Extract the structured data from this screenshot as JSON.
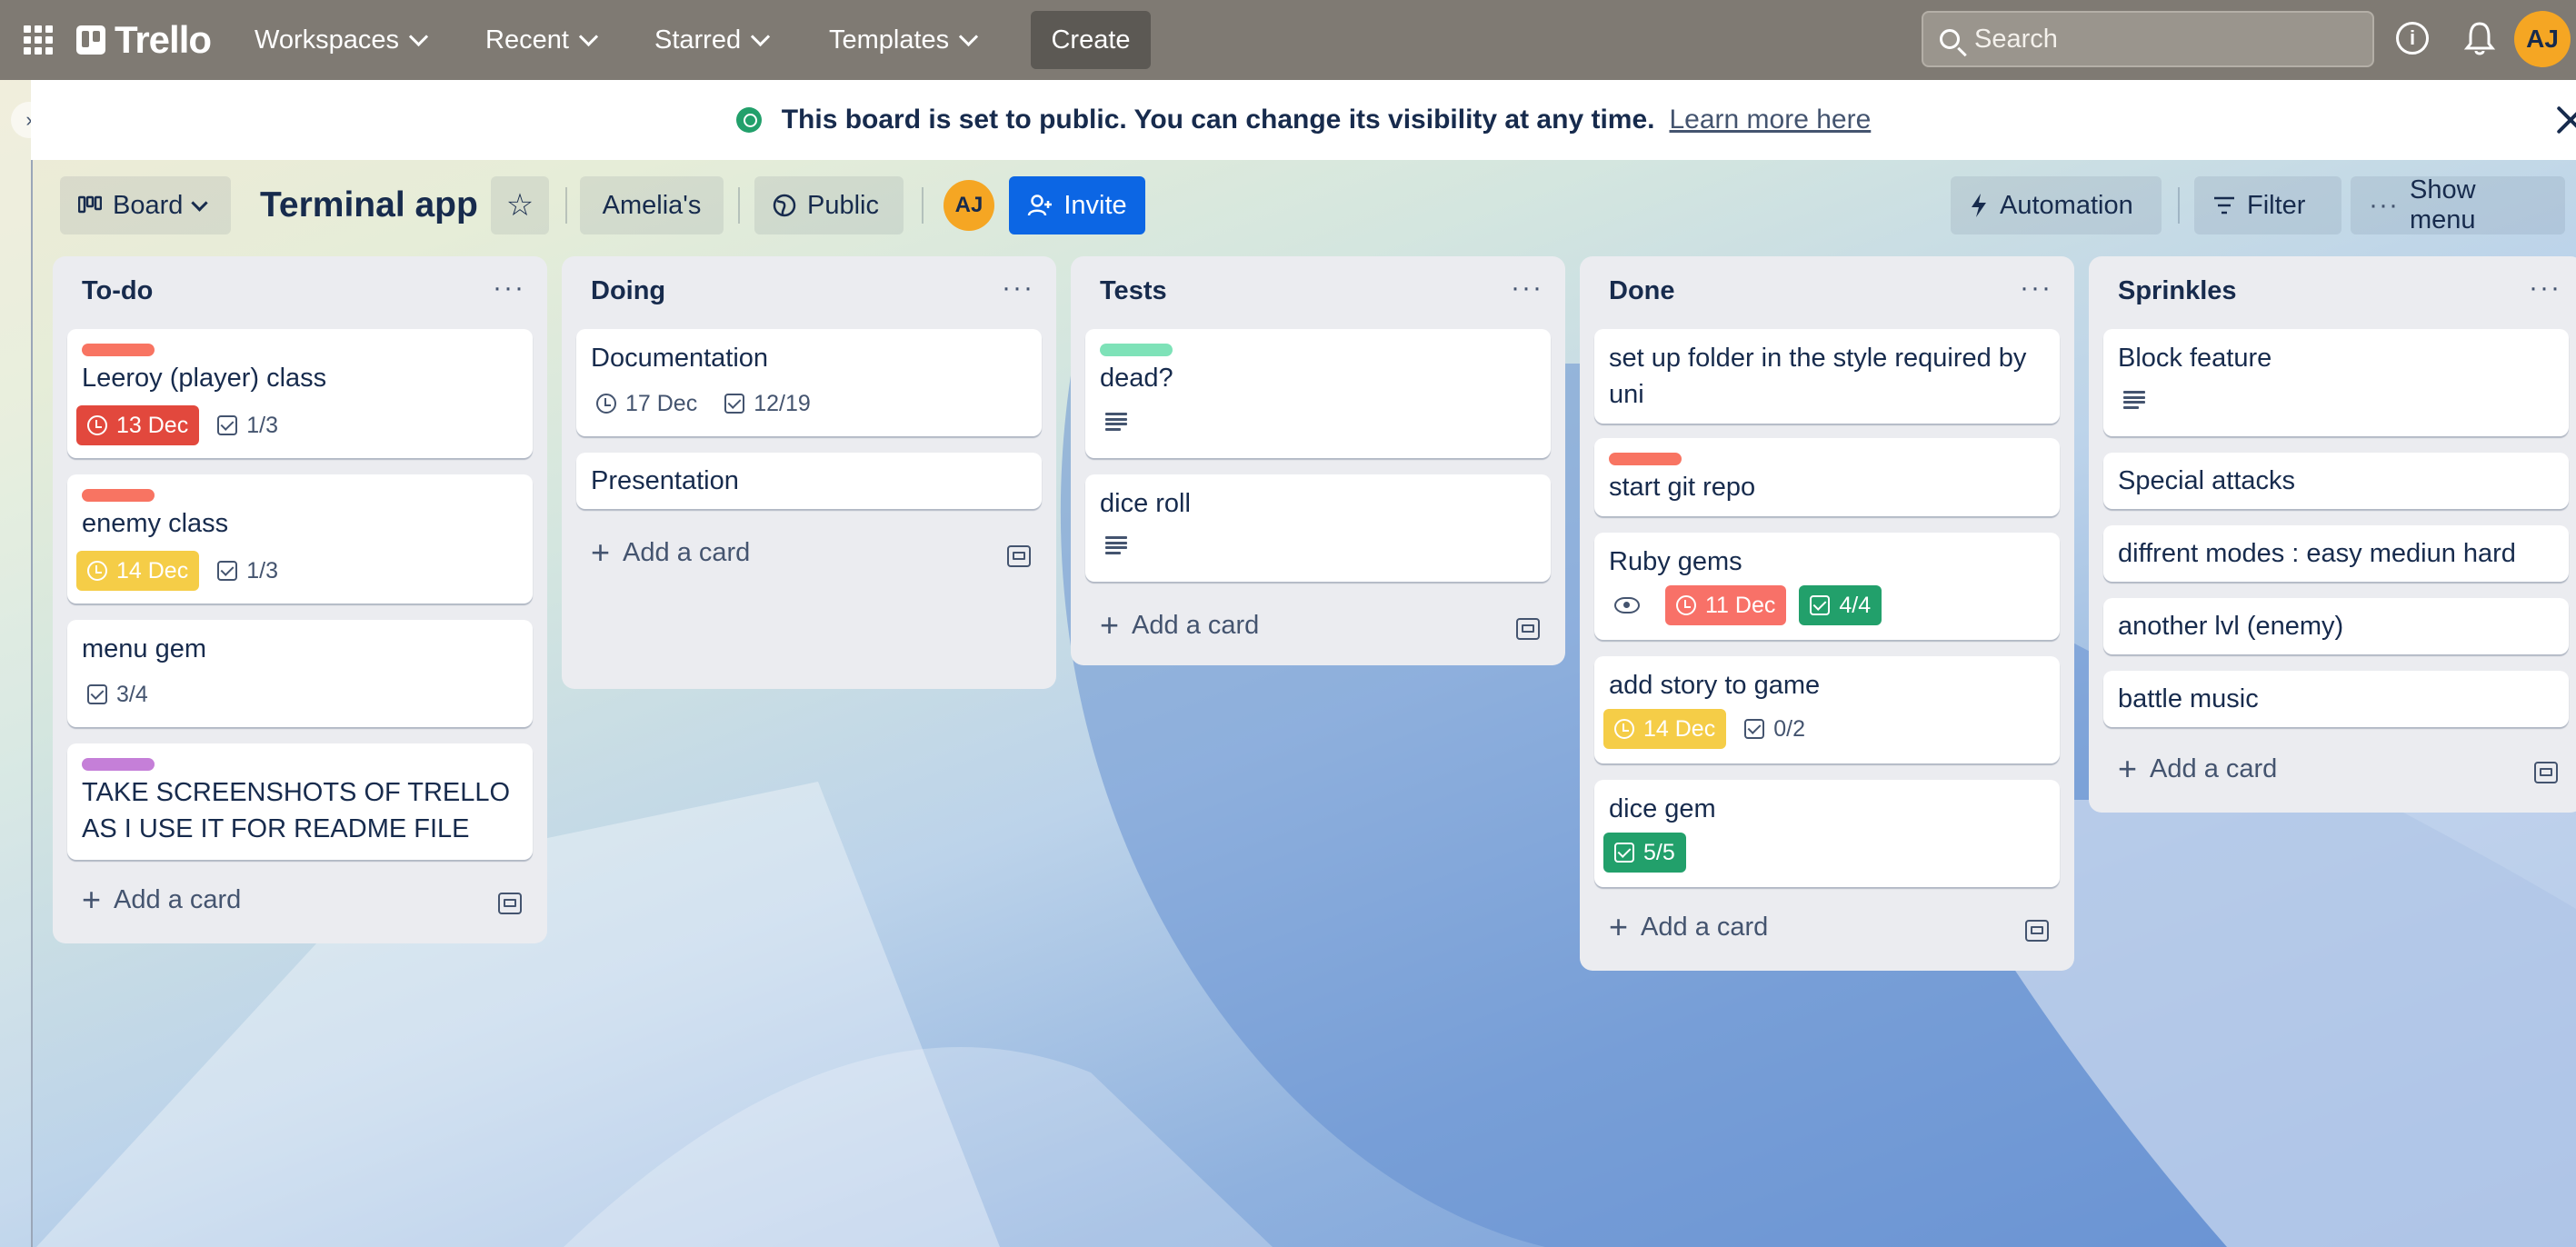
{
  "topnav": {
    "logo_text": "Trello",
    "workspaces": "Workspaces",
    "recent": "Recent",
    "starred": "Starred",
    "templates": "Templates",
    "create": "Create",
    "search_placeholder": "Search",
    "avatar_initials": "AJ"
  },
  "banner": {
    "text": "This board is set to public. You can change its visibility at any time.",
    "link": "Learn more here"
  },
  "board_header": {
    "view": "Board",
    "title": "Terminal app",
    "workspace": "Amelia's",
    "visibility": "Public",
    "member_initials": "AJ",
    "invite": "Invite",
    "automation": "Automation",
    "filter": "Filter",
    "show_menu": "Show menu"
  },
  "colors": {
    "label_red": "#f87462",
    "label_green": "#7ee2b8",
    "label_purple": "#c57fd8",
    "due_red": "#e2483d",
    "due_yellow": "#f5cd47",
    "due_pink": "#f87168",
    "complete_green": "#22a06b"
  },
  "add_card": "Add a card",
  "lists": [
    {
      "title": "To-do",
      "cards": [
        {
          "title": "Leeroy (player) class",
          "label": "red",
          "due": "13 Dec",
          "due_style": "red",
          "checklist": "1/3"
        },
        {
          "title": "enemy class",
          "label": "red",
          "due": "14 Dec",
          "due_style": "yellow",
          "checklist": "1/3"
        },
        {
          "title": "menu gem",
          "checklist": "3/4"
        },
        {
          "title": "TAKE SCREENSHOTS OF TRELLO AS I USE IT FOR README FILE",
          "label": "purple"
        }
      ]
    },
    {
      "title": "Doing",
      "cards": [
        {
          "title": "Documentation",
          "due": "17 Dec",
          "checklist": "12/19"
        },
        {
          "title": "Presentation"
        }
      ]
    },
    {
      "title": "Tests",
      "cards": [
        {
          "title": "dead?",
          "label": "green",
          "description": true
        },
        {
          "title": "dice roll",
          "description": true
        }
      ]
    },
    {
      "title": "Done",
      "cards": [
        {
          "title": "set up folder in the style required by uni"
        },
        {
          "title": "start git repo",
          "label": "red"
        },
        {
          "title": "Ruby gems",
          "watching": true,
          "due": "11 Dec",
          "due_style": "pink",
          "checklist": "4/4",
          "checklist_style": "green"
        },
        {
          "title": "add story to game",
          "due": "14 Dec",
          "due_style": "yellow",
          "checklist": "0/2"
        },
        {
          "title": "dice gem",
          "checklist": "5/5",
          "checklist_style": "green"
        }
      ]
    },
    {
      "title": "Sprinkles",
      "cards": [
        {
          "title": "Block feature",
          "description": true
        },
        {
          "title": "Special attacks"
        },
        {
          "title": "diffrent modes : easy mediun hard"
        },
        {
          "title": "another lvl (enemy)"
        },
        {
          "title": "battle music"
        }
      ]
    }
  ]
}
